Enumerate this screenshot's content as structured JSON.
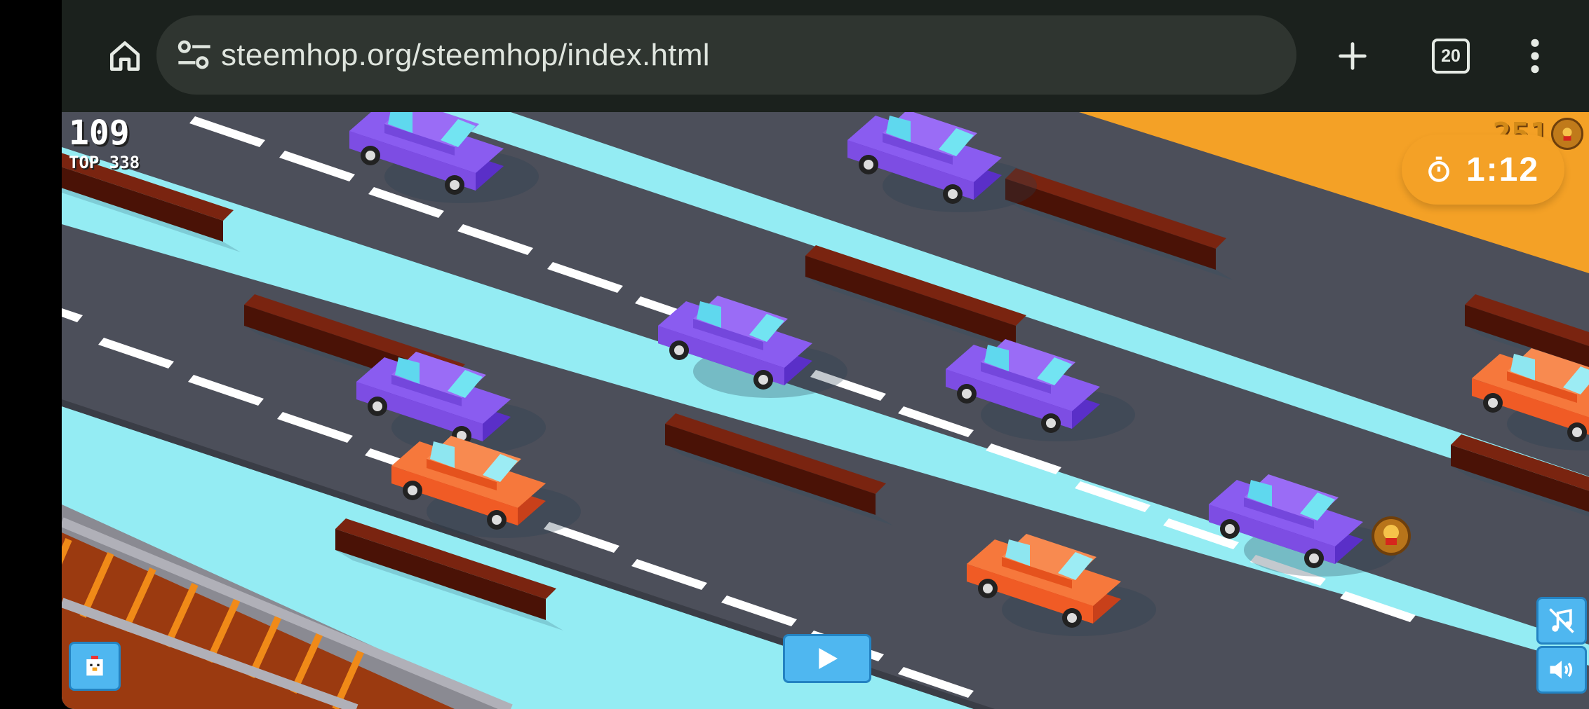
{
  "browser": {
    "url": "steemhop.org/steemhop/index.html",
    "tab_count": "20",
    "icons": [
      "home-icon",
      "site-settings-icon",
      "new-tab-icon",
      "tab-switcher-icon",
      "more-vert-icon"
    ]
  },
  "game": {
    "score": "109",
    "top_score": "TOP 338",
    "coins": "251",
    "timer": "1:12",
    "colors": {
      "road": "#4c4f5a",
      "water": "#94ecf3",
      "grass": "#f4a126",
      "purple_car": "#7d4de3",
      "orange_car": "#f05b25",
      "log": "#5a1608",
      "button": "#4fb7f0"
    },
    "buttons": [
      "play-button",
      "character-select-button",
      "music-toggle-button",
      "sound-toggle-button"
    ]
  }
}
